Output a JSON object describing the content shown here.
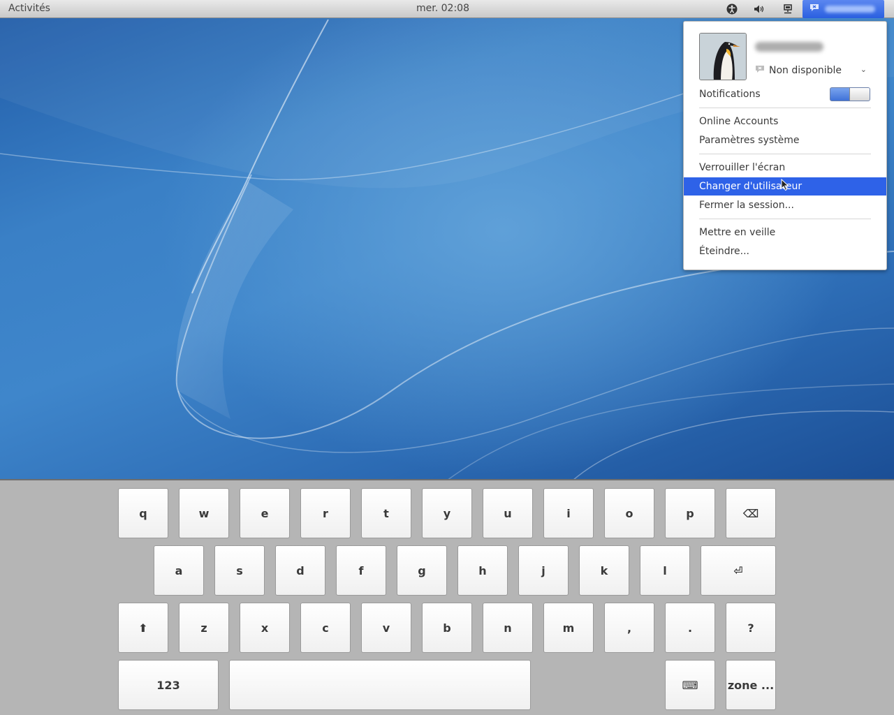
{
  "topbar": {
    "activities": "Activités",
    "clock": "mer. 02:08",
    "icons": [
      "accessibility-icon",
      "volume-icon",
      "network-icon",
      "user-status-icon"
    ]
  },
  "user_menu": {
    "status": "Non disponible",
    "notifications_label": "Notifications",
    "notifications_enabled": true,
    "items": [
      "Online Accounts",
      "Paramètres système",
      "Verrouiller l'écran",
      "Changer d'utilisateur",
      "Fermer la session...",
      "Mettre en veille",
      "Éteindre..."
    ],
    "active_item": "Changer d'utilisateur"
  },
  "keyboard": {
    "row1": [
      "q",
      "w",
      "e",
      "r",
      "t",
      "y",
      "u",
      "i",
      "o",
      "p",
      "⌫"
    ],
    "row2": [
      "a",
      "s",
      "d",
      "f",
      "g",
      "h",
      "j",
      "k",
      "l",
      "⏎"
    ],
    "row3": [
      "⬆",
      "z",
      "x",
      "c",
      "v",
      "b",
      "n",
      "m",
      ",",
      ".",
      "?"
    ],
    "row4": {
      "numbers": "123",
      "space": "",
      "keyboard_icon": "⌨",
      "zone": "zone ..."
    }
  },
  "colors": {
    "menu_highlight": "#2e62e8",
    "topbar_user_button": "#2a5fe0",
    "keyboard_bg": "#b5b5b5"
  }
}
